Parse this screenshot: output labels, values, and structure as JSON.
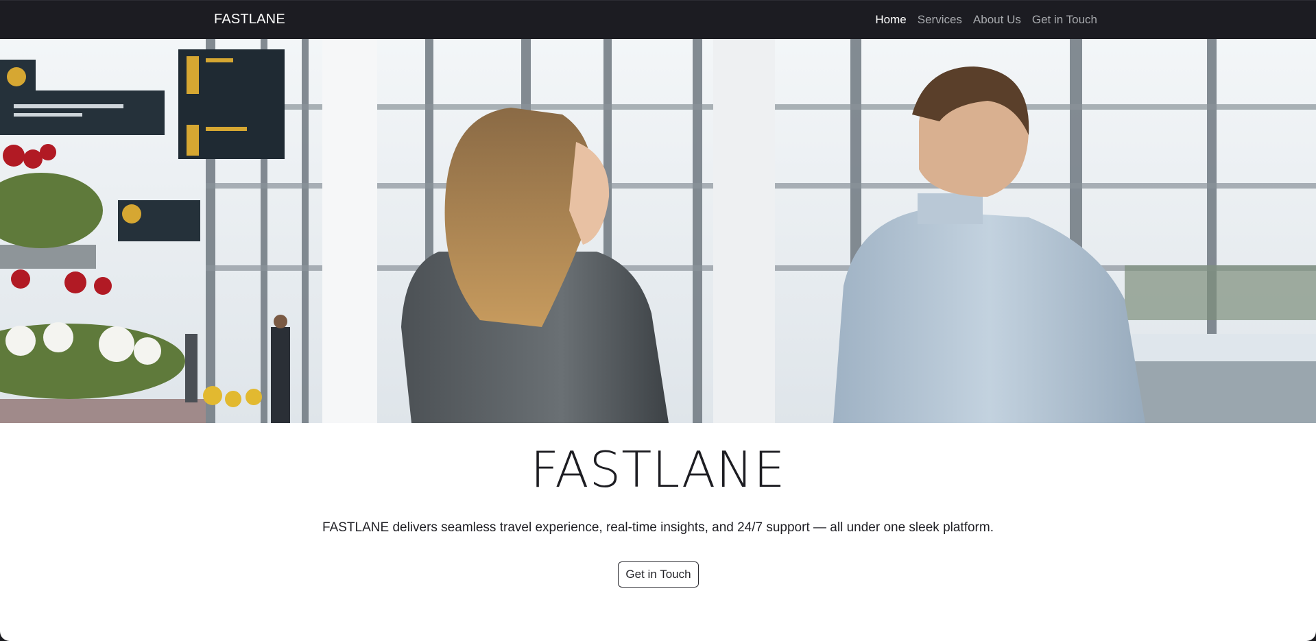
{
  "navbar": {
    "brand": "FASTLANE",
    "links": [
      {
        "label": "Home",
        "active": true
      },
      {
        "label": "Services",
        "active": false
      },
      {
        "label": "About Us",
        "active": false
      },
      {
        "label": "Get in Touch",
        "active": false
      }
    ]
  },
  "hero": {
    "title": "FASTLANE",
    "description": "FASTLANE delivers seamless travel experience, real-time insights, and 24/7 support — all under one sleek platform.",
    "cta_label": "Get in Touch"
  },
  "colors": {
    "navbar_bg": "#1c1c22",
    "nav_active": "#ffffff",
    "nav_inactive": "#a7a9ad",
    "text": "#1d1d22"
  }
}
